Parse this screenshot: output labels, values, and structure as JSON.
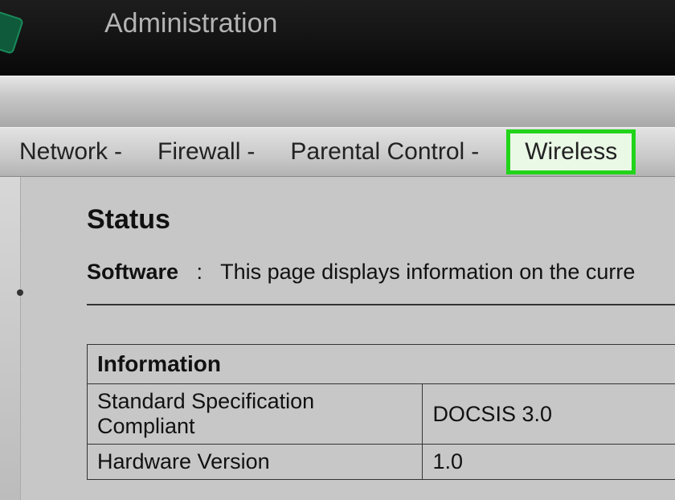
{
  "header": {
    "title": "Administration"
  },
  "nav": {
    "items": [
      {
        "label": "Network",
        "has_dropdown": true
      },
      {
        "label": "Firewall",
        "has_dropdown": true
      },
      {
        "label": "Parental Control",
        "has_dropdown": true
      },
      {
        "label": "Wireless",
        "has_dropdown": false,
        "highlight": true
      }
    ]
  },
  "status": {
    "title": "Status",
    "section_label": "Software",
    "section_desc": "This page displays information on the curre"
  },
  "info_table": {
    "header": "Information",
    "rows": [
      {
        "key": "Standard Specification Compliant",
        "value": "DOCSIS 3.0"
      },
      {
        "key": "Hardware Version",
        "value": "1.0"
      }
    ]
  }
}
